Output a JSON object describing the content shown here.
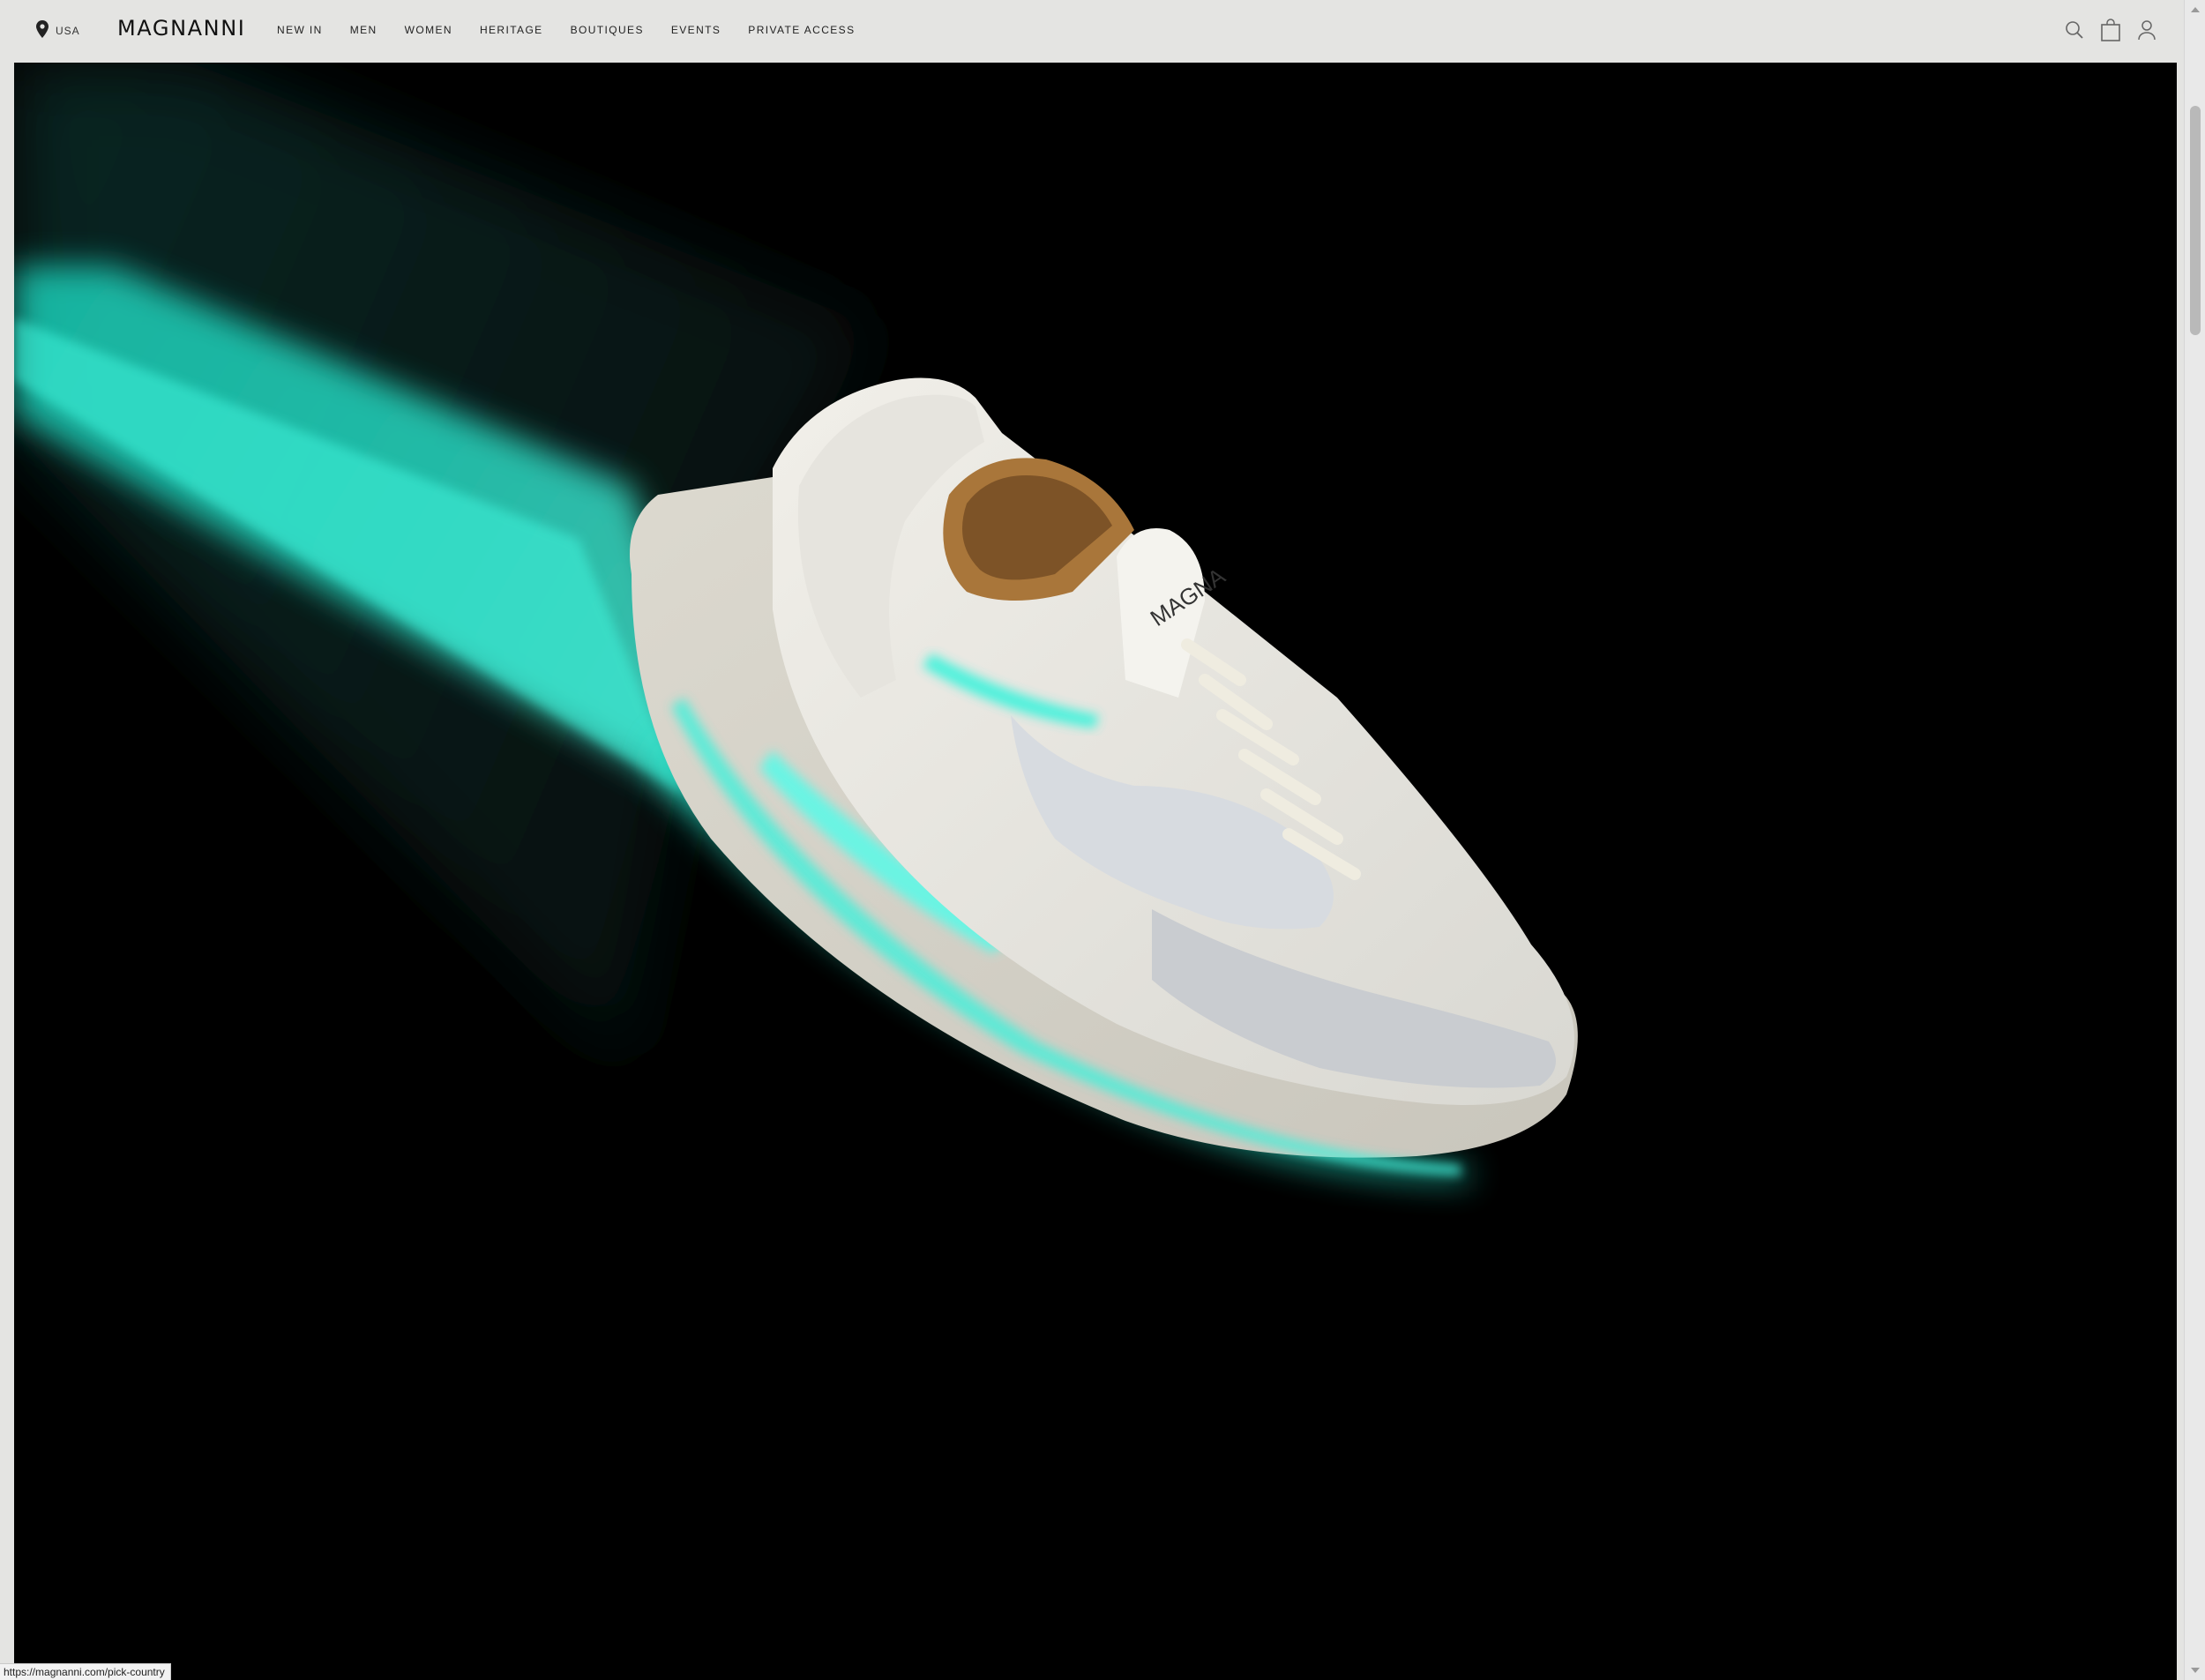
{
  "header": {
    "country": "USA",
    "logo": "MAGNANNI",
    "nav": [
      "NEW IN",
      "MEN",
      "WOMEN",
      "HERITAGE",
      "BOUTIQUES",
      "EVENTS",
      "PRIVATE ACCESS"
    ],
    "icons": [
      "location-pin-icon",
      "search-icon",
      "shopping-bag-icon",
      "account-icon"
    ]
  },
  "hero": {
    "image": "white-sneaker-teal-light-trail",
    "shoe_text": "MAGNA",
    "colors": {
      "background": "#000000",
      "trail": "#2ee8d0",
      "shoe": "#e8e6e0"
    }
  },
  "status_bar": {
    "url": "https://magnanni.com/pick-country"
  }
}
